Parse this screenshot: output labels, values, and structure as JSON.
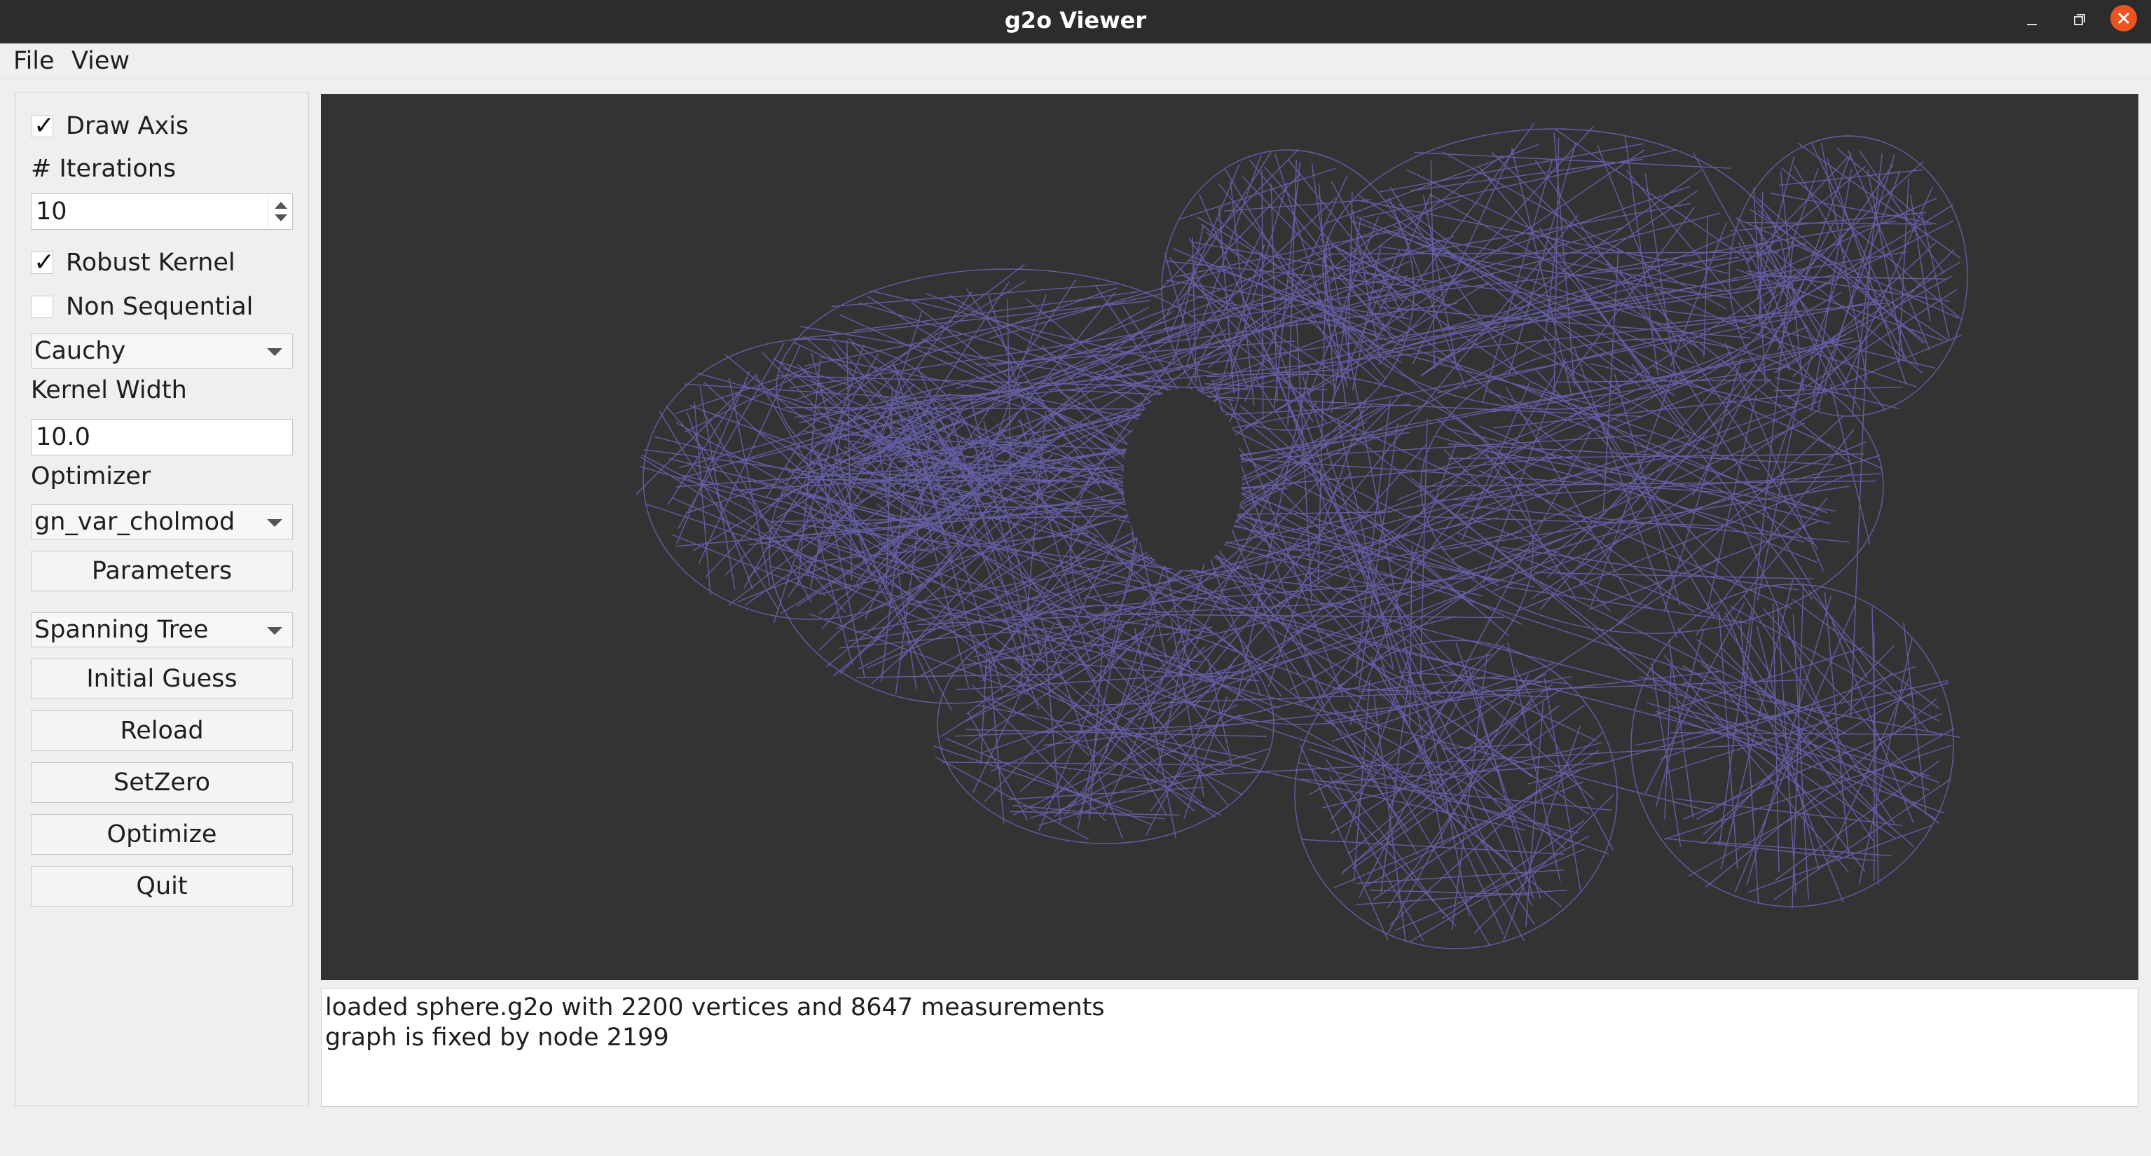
{
  "window": {
    "title": "g2o Viewer"
  },
  "menu": {
    "items": [
      "File",
      "View"
    ]
  },
  "sidebar": {
    "draw_axis": {
      "label": "Draw Axis",
      "checked": true
    },
    "iterations": {
      "label": "# Iterations",
      "value": "10"
    },
    "robust_kernel": {
      "label": "Robust Kernel",
      "checked": true
    },
    "non_sequential": {
      "label": "Non Sequential",
      "checked": false
    },
    "kernel_select": {
      "value": "Cauchy"
    },
    "kernel_width": {
      "label": "Kernel Width",
      "value": "10.0"
    },
    "optimizer": {
      "label": "Optimizer",
      "value": "gn_var_cholmod"
    },
    "parameters_button": "Parameters",
    "init_select": {
      "value": "Spanning Tree"
    },
    "initial_guess_button": "Initial Guess",
    "reload_button": "Reload",
    "setzero_button": "SetZero",
    "optimize_button": "Optimize",
    "quit_button": "Quit"
  },
  "viewer": {
    "background": "#333333",
    "graph_color": "#6b63b3"
  },
  "log": {
    "lines": [
      "loaded sphere.g2o with 2200 vertices and 8647 measurements",
      "graph is fixed by node 2199"
    ]
  },
  "colors": {
    "close_button": "#e95420",
    "titlebar": "#2c2c2c"
  }
}
